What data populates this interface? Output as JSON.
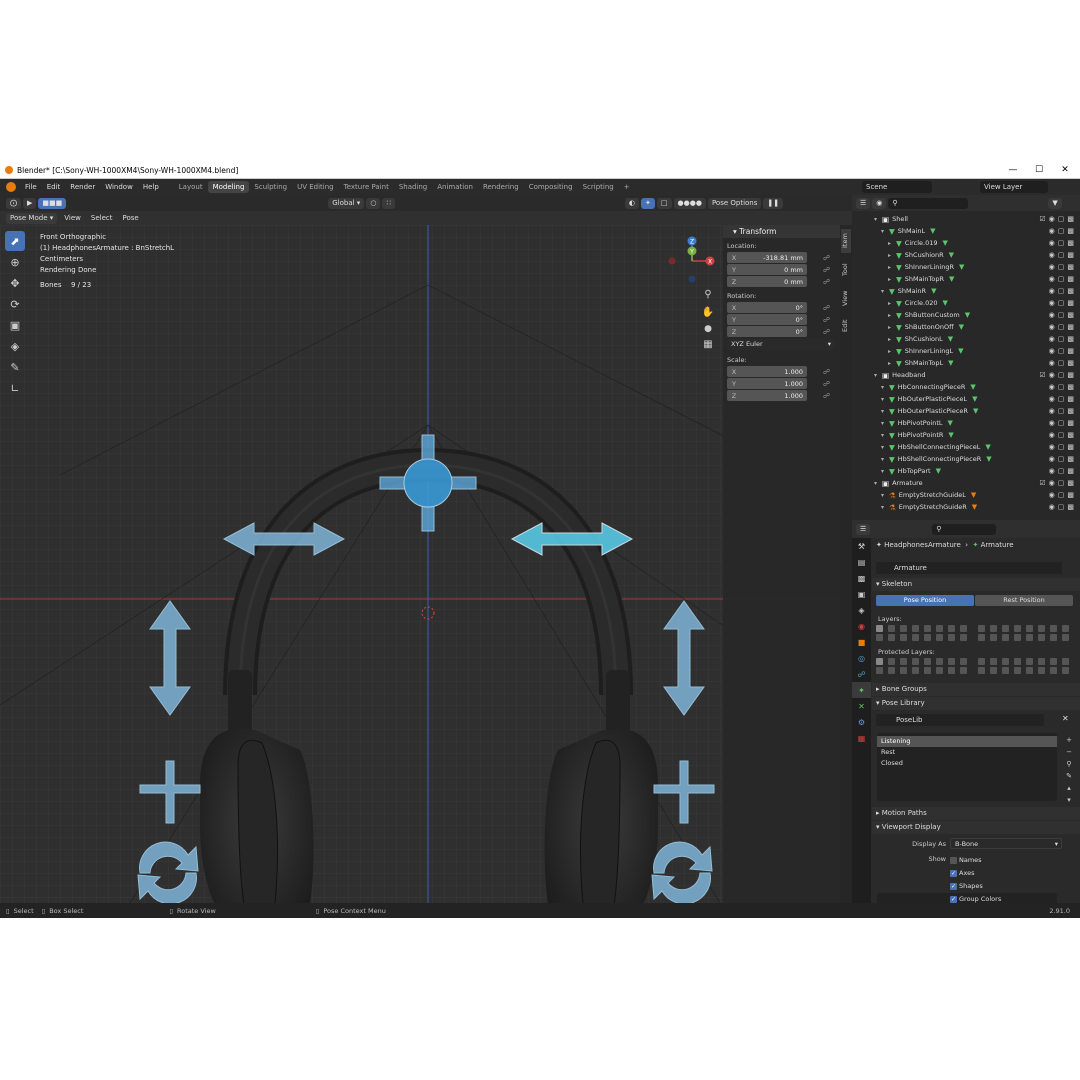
{
  "window": {
    "title": "Blender* [C:\\Sony-WH-1000XM4\\Sony-WH-1000XM4.blend]"
  },
  "menu": {
    "items": [
      "File",
      "Edit",
      "Render",
      "Window",
      "Help"
    ]
  },
  "workspaces": [
    "Layout",
    "Modeling",
    "Sculpting",
    "UV Editing",
    "Texture Paint",
    "Shading",
    "Animation",
    "Rendering",
    "Compositing",
    "Scripting"
  ],
  "active_workspace": "Modeling",
  "scene": {
    "name": "Scene",
    "view_layer": "View Layer"
  },
  "header": {
    "mode": "Pose Mode",
    "view": "View",
    "select": "Select",
    "pose": "Pose",
    "transform_orientation": "Global",
    "pose_options": "Pose Options"
  },
  "viewport": {
    "view_name": "Front Orthographic",
    "object_line": "(1) HeadphonesArmature : BnStretchL",
    "units": "Centimeters",
    "render_status": "Rendering Done",
    "bones_label": "Bones",
    "bones_value": "9 / 23",
    "gizmo_labels": {
      "z": "Z",
      "y": "Y",
      "x": "X"
    }
  },
  "npanel": {
    "title": "Transform",
    "location_label": "Location:",
    "location": {
      "x": "-318.81 mm",
      "y": "0 mm",
      "z": "0 mm"
    },
    "rotation_label": "Rotation:",
    "rotation": {
      "x": "0°",
      "y": "0°",
      "z": "0°"
    },
    "rotation_mode": "XYZ Euler",
    "scale_label": "Scale:",
    "scale": {
      "x": "1.000",
      "y": "1.000",
      "z": "1.000"
    },
    "axis": {
      "x": "X",
      "y": "Y",
      "z": "Z"
    },
    "tabs": [
      "Item",
      "Tool",
      "View",
      "Edit"
    ]
  },
  "outliner": {
    "rows": [
      {
        "label": "Shell",
        "indent": 2,
        "icon": "collection"
      },
      {
        "label": "ShMainL",
        "indent": 3,
        "icon": "mesh"
      },
      {
        "label": "Circle.019",
        "indent": 4,
        "icon": "mesh"
      },
      {
        "label": "ShCushionR",
        "indent": 4,
        "icon": "mesh"
      },
      {
        "label": "ShInnerLiningR",
        "indent": 4,
        "icon": "mesh"
      },
      {
        "label": "ShMainTopR",
        "indent": 4,
        "icon": "mesh"
      },
      {
        "label": "ShMainR",
        "indent": 3,
        "icon": "mesh"
      },
      {
        "label": "Circle.020",
        "indent": 4,
        "icon": "mesh"
      },
      {
        "label": "ShButtonCustom",
        "indent": 4,
        "icon": "mesh"
      },
      {
        "label": "ShButtonOnOff",
        "indent": 4,
        "icon": "mesh"
      },
      {
        "label": "ShCushionL",
        "indent": 4,
        "icon": "mesh"
      },
      {
        "label": "ShInnerLiningL",
        "indent": 4,
        "icon": "mesh"
      },
      {
        "label": "ShMainTopL",
        "indent": 4,
        "icon": "mesh"
      },
      {
        "label": "Headband",
        "indent": 2,
        "icon": "collection"
      },
      {
        "label": "HbConnectingPieceR",
        "indent": 3,
        "icon": "mesh"
      },
      {
        "label": "HbOuterPlasticPieceL",
        "indent": 3,
        "icon": "mesh"
      },
      {
        "label": "HbOuterPlasticPieceR",
        "indent": 3,
        "icon": "mesh"
      },
      {
        "label": "HbPivotPointL",
        "indent": 3,
        "icon": "mesh"
      },
      {
        "label": "HbPivotPointR",
        "indent": 3,
        "icon": "mesh"
      },
      {
        "label": "HbShellConnectingPieceL",
        "indent": 3,
        "icon": "mesh"
      },
      {
        "label": "HbShellConnectingPieceR",
        "indent": 3,
        "icon": "mesh"
      },
      {
        "label": "HbTopPart",
        "indent": 3,
        "icon": "mesh"
      },
      {
        "label": "Armature",
        "indent": 2,
        "icon": "collection"
      },
      {
        "label": "EmptyStretchGuideL",
        "indent": 3,
        "icon": "empty"
      },
      {
        "label": "EmptyStretchGuideR",
        "indent": 3,
        "icon": "empty"
      }
    ]
  },
  "properties": {
    "object_name": "HeadphonesArmature",
    "data_name": "Armature",
    "datablock": "Armature",
    "skeleton": "Skeleton",
    "pose_position": "Pose Position",
    "rest_position": "Rest Position",
    "layers": "Layers:",
    "protected_layers": "Protected Layers:",
    "bone_groups": "Bone Groups",
    "pose_library": "Pose Library",
    "poselib_name": "PoseLib",
    "poses": [
      "Listening",
      "Rest",
      "Closed"
    ],
    "motion_paths": "Motion Paths",
    "viewport_display": "Viewport Display",
    "display_as_label": "Display As",
    "display_as_value": "B-Bone",
    "show_label": "Show",
    "show_options": [
      {
        "label": "Names",
        "checked": false
      },
      {
        "label": "Axes",
        "checked": true
      },
      {
        "label": "Shapes",
        "checked": true
      },
      {
        "label": "Group Colors",
        "checked": true
      }
    ]
  },
  "status": {
    "select": "Select",
    "box_select": "Box Select",
    "rotate_view": "Rotate View",
    "context_menu": "Pose Context Menu",
    "version": "2.91.0"
  },
  "colors": {
    "accent": "#4772b3",
    "bone_blue": "#7fb4d8",
    "bone_selected": "#5ad2f0",
    "axis_red": "#b03a3a",
    "axis_blue": "#3a5fb0",
    "orange": "#e87d0d",
    "green": "#5cc46a"
  }
}
